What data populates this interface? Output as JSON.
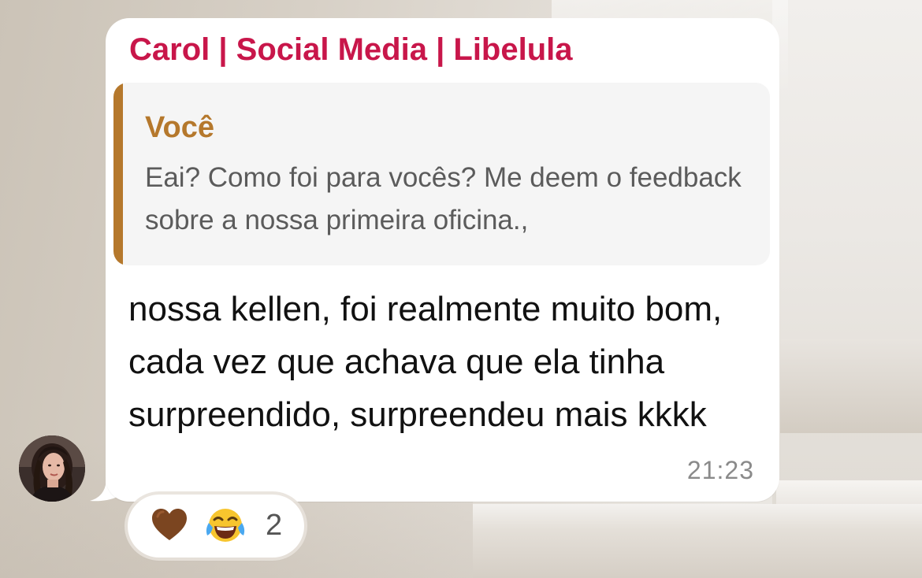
{
  "message": {
    "sender": "Carol | Social Media | Libelula",
    "reply": {
      "author": "Você",
      "text": "Eai? Como foi para vocês? Me deem o feedback sobre a nossa primeira oficina.,"
    },
    "text": "nossa kellen, foi realmente muito bom, cada vez que achava que ela tinha surpreendido, surpreendeu mais kkkk",
    "time": "21:23"
  },
  "reactions": {
    "emojis": [
      "brown-heart-icon",
      "face-with-tears-of-joy-icon"
    ],
    "count": "2"
  },
  "colors": {
    "sender": "#c8164a",
    "reply_accent": "#b5782c",
    "bubble": "#ffffff",
    "timestamp": "#8a8a8a"
  }
}
